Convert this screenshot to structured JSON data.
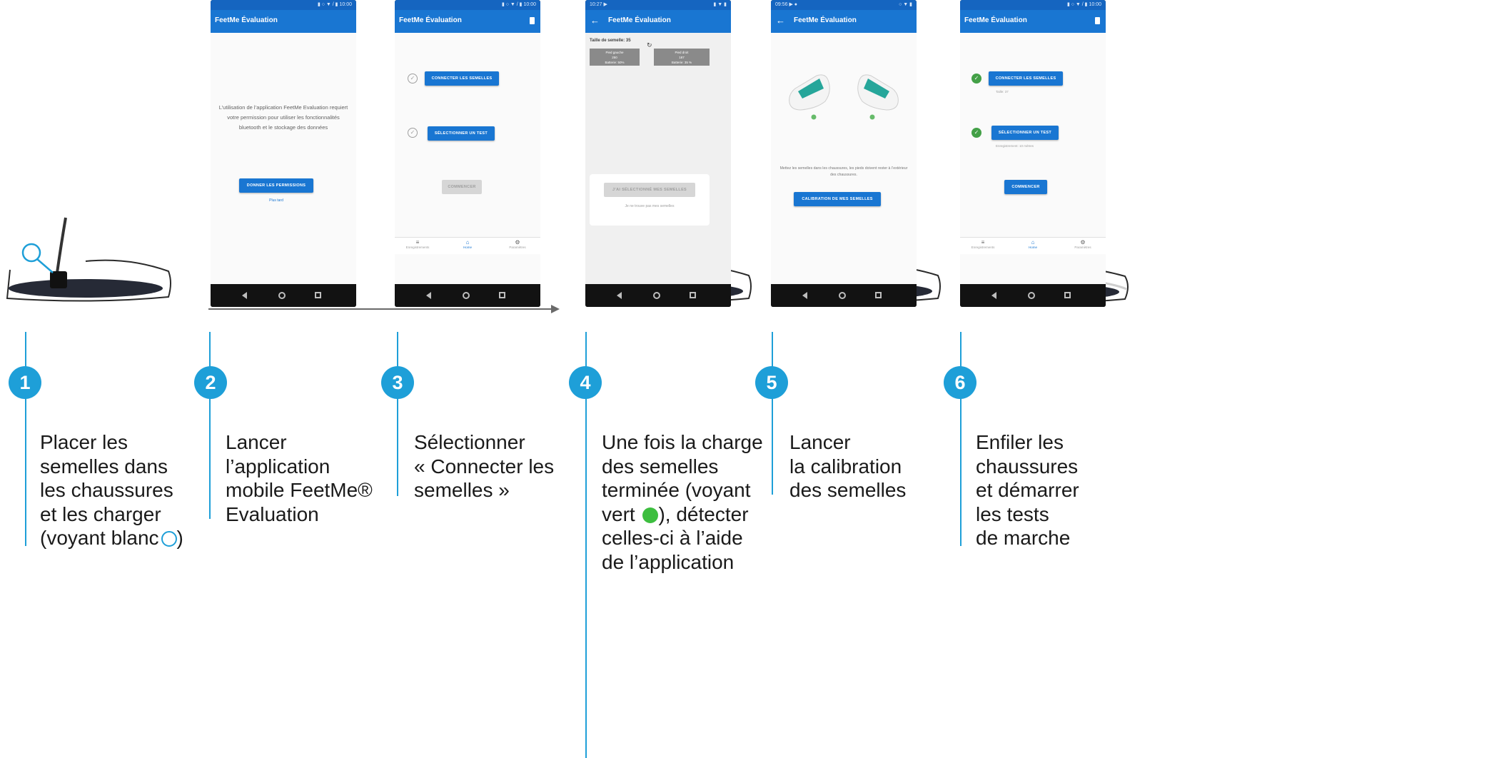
{
  "colors": {
    "accent": "#1E9FD8",
    "app_bar": "#1976D2",
    "led_green": "#3DBE3F",
    "check_green": "#43A047"
  },
  "steps": [
    {
      "number": "1",
      "text_main": "Placer les\nsemelles dans\nles chaussures\net les charger\n(voyant blanc",
      "text_tail": ")"
    },
    {
      "number": "2",
      "text_main": "Lancer\nl’application\nmobile FeetMe®\nEvaluation"
    },
    {
      "number": "3",
      "text_main": "Sélectionner\n« Connecter les\nsemelles »"
    },
    {
      "number": "4",
      "text_main": "Une fois la charge\ndes semelles\nterminée (voyant\nvert ",
      "text_tail": "), détecter\ncelles-ci à l’aide\nde l’application"
    },
    {
      "number": "5",
      "text_main": "Lancer\nla calibration\ndes semelles"
    },
    {
      "number": "6",
      "text_main": "Enfiler les\nchaussures\net démarrer\nles tests\nde marche"
    }
  ],
  "phones": {
    "p2": {
      "status_right": "▮ ○ ▼ / ▮ 10:00",
      "title": "FeetMe Évaluation",
      "permission_text": "L’utilisation de l’application FeetMe Evaluation requiert votre permission pour utiliser les fonctionnalités bluetooth et le stockage des données",
      "grant_button": "DONNER LES PERMISSIONS",
      "later_link": "Plus tard"
    },
    "p3": {
      "status_right": "▮ ○ ▼ / ▮ 10:00",
      "title": "FeetMe Évaluation",
      "connect_button": "CONNECTER LES SEMELLES",
      "select_test_button": "SÉLECTIONNER UN TEST",
      "start_button": "COMMENCER",
      "tabs": [
        "Enregistrements",
        "Home",
        "Paramètres"
      ]
    },
    "p4": {
      "status_left": "10:27 ▶",
      "status_right": "▮ ▼ ▮",
      "title": "FeetMe Évaluation",
      "size_label": "Taille de semelle: 35",
      "left_foot": {
        "name": "Pied gauche",
        "id": "250",
        "battery": "Batterie: 50%"
      },
      "right_foot": {
        "name": "Pied droit",
        "id": "187",
        "battery": "Batterie: 35 %"
      },
      "use_button": "J’AI SÉLECTIONNÉ MES SEMELLES",
      "not_found": "Je ne trouve pas mes semelles"
    },
    "p5": {
      "status_left": "09:56 ▶ ●",
      "status_right": "○ ▼ ▮",
      "title": "FeetMe Évaluation",
      "instruction": "Mettez les semelles dans les chaussures, les pieds doivent rester à l’extérieur des chaussures.",
      "calibrate_button": "CALIBRATION DE MES SEMELLES"
    },
    "p6": {
      "status_right": "▮ ○ ▼ / ▮ 10:00",
      "title": "FeetMe Évaluation",
      "connect_button": "CONNECTER LES SEMELLES",
      "size_note": "Taille: 37",
      "select_test_button": "SÉLECTIONNER UN TEST",
      "test_note": "Enregistrement: 10 mètres",
      "start_button": "COMMENCER",
      "tabs": [
        "Enregistrements",
        "Home",
        "Paramètres"
      ]
    }
  }
}
